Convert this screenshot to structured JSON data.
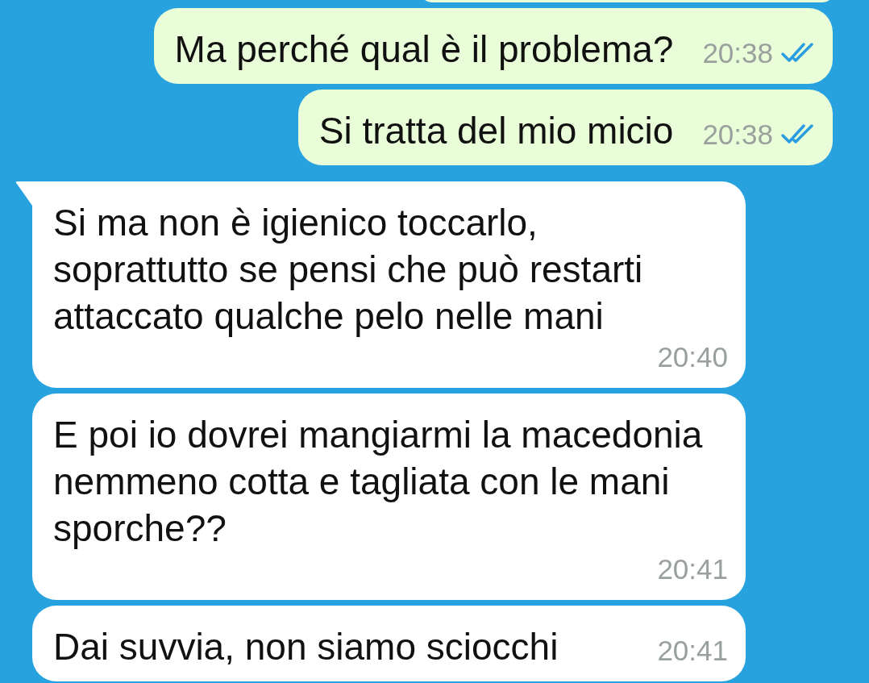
{
  "messages": [
    {
      "kind": "outgoing",
      "text": "Ma perché qual è il problema?",
      "time": "20:38",
      "read": true
    },
    {
      "kind": "outgoing",
      "text": "Si tratta del mio micio",
      "time": "20:38",
      "read": true
    },
    {
      "kind": "incoming",
      "tail": true,
      "text": "Si ma non è igienico toccarlo,\nsoprattutto se pensi che può restarti\nattaccato qualche pelo nelle mani",
      "time": "20:40"
    },
    {
      "kind": "incoming",
      "tail": false,
      "text": "E poi io dovrei mangiarmi la macedonia\nnemmeno cotta e tagliata con le mani\nsporche??",
      "time": "20:41"
    },
    {
      "kind": "incoming",
      "tail": false,
      "text": "Dai suvvia, non siamo sciocchi",
      "time": "20:41"
    }
  ]
}
